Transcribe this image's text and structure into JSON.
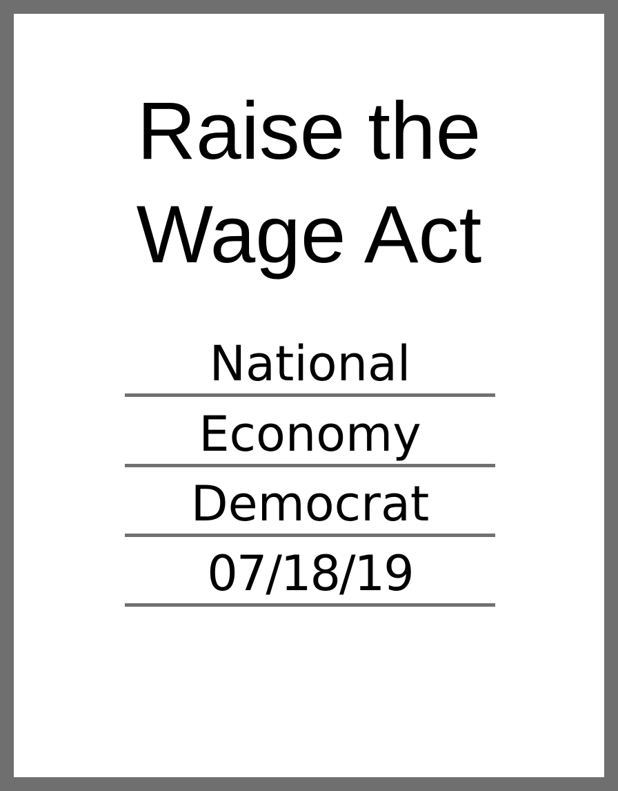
{
  "document": {
    "title_line1": "Raise the",
    "title_line2": "Wage Act",
    "fields": [
      {
        "value": "National"
      },
      {
        "value": "Economy"
      },
      {
        "value": "Democrat"
      },
      {
        "value": "07/18/19"
      }
    ]
  },
  "colors": {
    "border": "#6f6f6f",
    "rule": "#707070",
    "text": "#000000",
    "background": "#ffffff"
  }
}
